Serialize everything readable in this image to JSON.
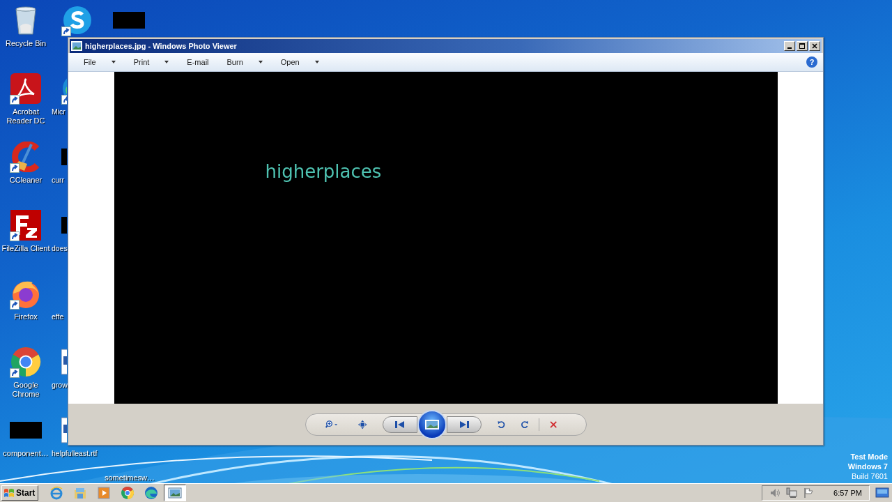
{
  "desktop": {
    "columns": [
      [
        {
          "label": "Recycle Bin",
          "kind": "recycle",
          "shortcut": false
        },
        {
          "label": "Acrobat Reader DC",
          "kind": "acrobat",
          "shortcut": true
        },
        {
          "label": "CCleaner",
          "kind": "ccleaner",
          "shortcut": true
        },
        {
          "label": "FileZilla Client",
          "kind": "filezilla",
          "shortcut": true
        },
        {
          "label": "Firefox",
          "kind": "firefox",
          "shortcut": true
        },
        {
          "label": "Google Chrome",
          "kind": "chrome",
          "shortcut": true
        },
        {
          "label": "component…",
          "kind": "redacted",
          "shortcut": false
        }
      ],
      [
        {
          "kind": "skype",
          "shortcut": true
        },
        {
          "label": "Micr",
          "kind": "edge",
          "shortcut": true
        },
        {
          "label": "curr",
          "kind": "redacted",
          "shortcut": false
        },
        {
          "label": "does",
          "kind": "redacted",
          "shortcut": false
        },
        {
          "label": "effe",
          "kind": "other"
        },
        {
          "label": "grow",
          "kind": "document",
          "shortcut": false
        },
        {
          "label": "helpfulleast.rtf",
          "kind": "document",
          "shortcut": false
        }
      ],
      [
        {
          "kind": "redacted",
          "shortcut": false
        },
        {
          "label": "sometimesw…",
          "kind": "other"
        }
      ]
    ]
  },
  "window": {
    "title": "higherplaces.jpg - Windows Photo Viewer",
    "menu": [
      {
        "label": "File",
        "dropdown": true
      },
      {
        "label": "Print",
        "dropdown": true
      },
      {
        "label": "E-mail",
        "dropdown": false
      },
      {
        "label": "Burn",
        "dropdown": true
      },
      {
        "label": "Open",
        "dropdown": true
      }
    ],
    "help": "?",
    "image_text": "higherplaces"
  },
  "os_notice": [
    "Test Mode",
    "Windows 7",
    "Build 7601"
  ],
  "taskbar": {
    "start": "Start",
    "apps": [
      {
        "kind": "ie",
        "active": false
      },
      {
        "kind": "explorer",
        "active": false
      },
      {
        "kind": "media",
        "active": false
      },
      {
        "kind": "chrome",
        "active": false
      },
      {
        "kind": "edge",
        "active": false
      },
      {
        "kind": "photos",
        "active": true
      }
    ],
    "clock": "6:57 PM"
  }
}
